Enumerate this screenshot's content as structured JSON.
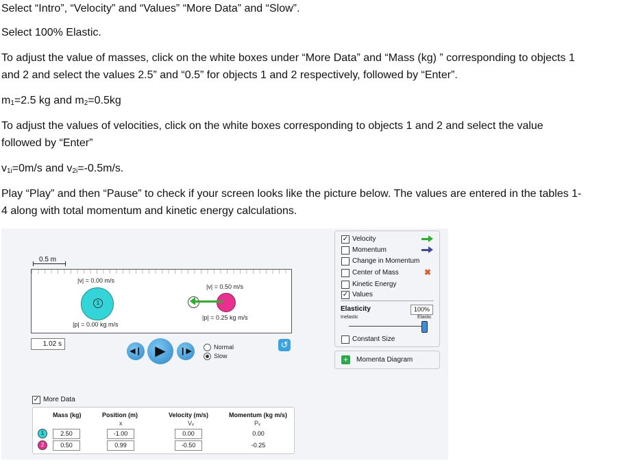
{
  "doc": {
    "p1": "Select “Intro”, “Velocity” and “Values” “More Data” and “Slow”.",
    "p2": "Select 100% Elastic.",
    "p3a": "To adjust the value of masses, click on the white boxes under “More Data” and “Mass (kg) ” corresponding to objects 1",
    "p3b": "and 2 and select the values 2.5” and “0.5”  for objects 1 and 2 respectively, followed by “Enter”.",
    "p4_m": "m",
    "p4_s1": "1",
    "p4_mid": "=2.5 kg and m",
    "p4_s2": "2",
    "p4_end": "=0.5kg",
    "p5a": " To adjust the values of velocities, click on the white boxes corresponding to objects 1 and 2 and select the value",
    "p5b": "followed by “Enter”",
    "p6_v": "v",
    "p6_s1": "1i",
    "p6_mid": "=0m/s and v",
    "p6_s2": "2i",
    "p6_end": "=-0.5m/s.",
    "p7a": "Play “Play” and then “Pause” to check if your screen looks like the picture below. The values are entered in the tables 1-",
    "p7b": "4 along with total momentum and kinetic energy calculations."
  },
  "sim": {
    "scale": "0.5 m",
    "ball1_v": "|v| = 0.00 m/s",
    "ball1_p": "|p| = 0.00 kg m/s",
    "ball1_num": "1",
    "ball2_v": "|v| = 0.50 m/s",
    "ball2_p": "|p| = 0.25 kg m/s",
    "time": "1.02 s",
    "speed_normal": "Normal",
    "speed_slow": "Slow",
    "panel": {
      "velocity": "Velocity",
      "momentum": "Momentum",
      "change": "Change in Momentum",
      "com": "Center of Mass",
      "ke": "Kinetic Energy",
      "values": "Values",
      "elasticity": "Elasticity",
      "elasticity_value": "100%",
      "inelastic": "Inelastic",
      "elastic": "Elastic",
      "constant_size": "Constant Size"
    },
    "momenta_diagram": "Momenta Diagram",
    "more_data": "More Data",
    "table": {
      "h_mass": "Mass (kg)",
      "h_pos": "Position (m)",
      "h_vel": "Velocity (m/s)",
      "h_mom": "Momentum (kg m/s)",
      "s_pos": "x",
      "s_vel": "Vₓ",
      "s_mom": "Pₓ",
      "rows": [
        {
          "id": "1",
          "mass": "2.50",
          "pos": "-1.00",
          "vel": "0.00",
          "mom": "0.00"
        },
        {
          "id": "2",
          "mass": "0.50",
          "pos": "0.99",
          "vel": "-0.50",
          "mom": "-0.25"
        }
      ]
    },
    "colors": {
      "ball1": "#34d5d8",
      "ball2": "#e8318e",
      "velocity_arrow": "#2ab02a",
      "momentum_arrow": "#3b4a9a"
    }
  }
}
